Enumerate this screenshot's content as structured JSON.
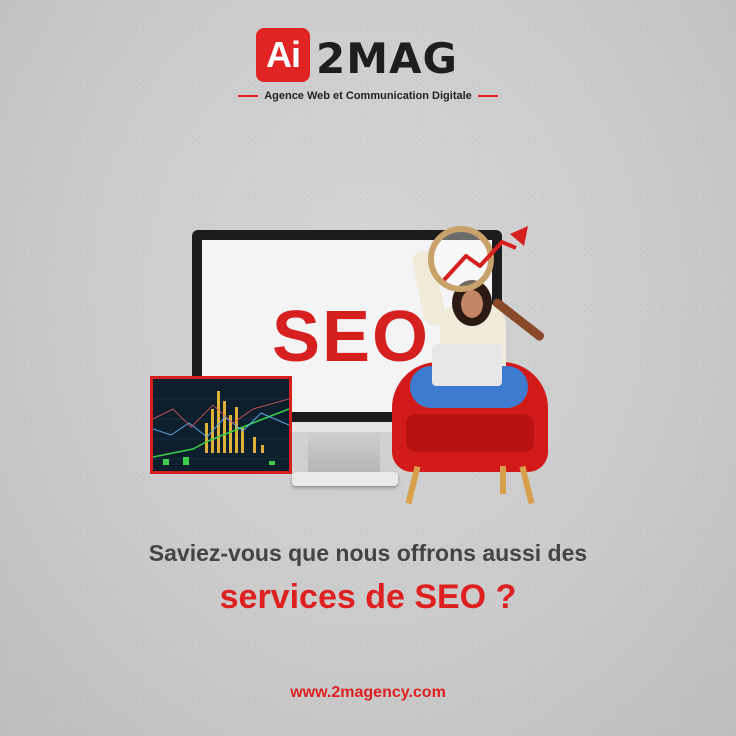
{
  "brand": {
    "logo_mark": "Ai",
    "logo_text": "2MAG",
    "tagline": "Agence Web et Communication Digitale",
    "accent_color": "#de2020"
  },
  "illustration": {
    "monitor_text": "SEO",
    "icons": [
      "monitor-icon",
      "stock-chart-tablet",
      "growth-arrow-icon",
      "magnifier-icon",
      "woman-on-armchair"
    ]
  },
  "message": {
    "question": "Saviez-vous que nous offrons aussi des",
    "highlight": "services de SEO ?"
  },
  "footer": {
    "website": "www.2magency.com"
  }
}
